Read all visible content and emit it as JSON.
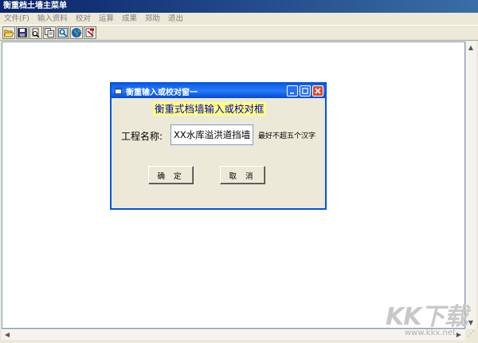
{
  "main_window": {
    "title": "衡重档土墙主菜单"
  },
  "menu": {
    "items": [
      "文件(F)",
      "输入资料",
      "校对",
      "运算",
      "成果",
      "郑助",
      "退出"
    ]
  },
  "toolbar": {
    "buttons": [
      "open-icon",
      "save-icon",
      "print-preview-icon",
      "copy-icon",
      "find-icon",
      "globe-icon",
      "edit-icon"
    ]
  },
  "dialog": {
    "title": "衡重输入或校对窗一",
    "heading": "衡重式档墙输入或校对框",
    "name_label": "工程名称:",
    "name_value": "XX水库溢洪道挡墙",
    "hint": "最好不超五个汉字",
    "ok_label": "确 定",
    "cancel_label": "取 消"
  },
  "watermark": {
    "logo": "KK下载",
    "url": "www.kkx.net"
  },
  "colors": {
    "title_bar": "#0a246a",
    "dialog_title": "#0a5fe8",
    "heading_bg": "#ffff80",
    "heading_text": "#0000c0"
  }
}
